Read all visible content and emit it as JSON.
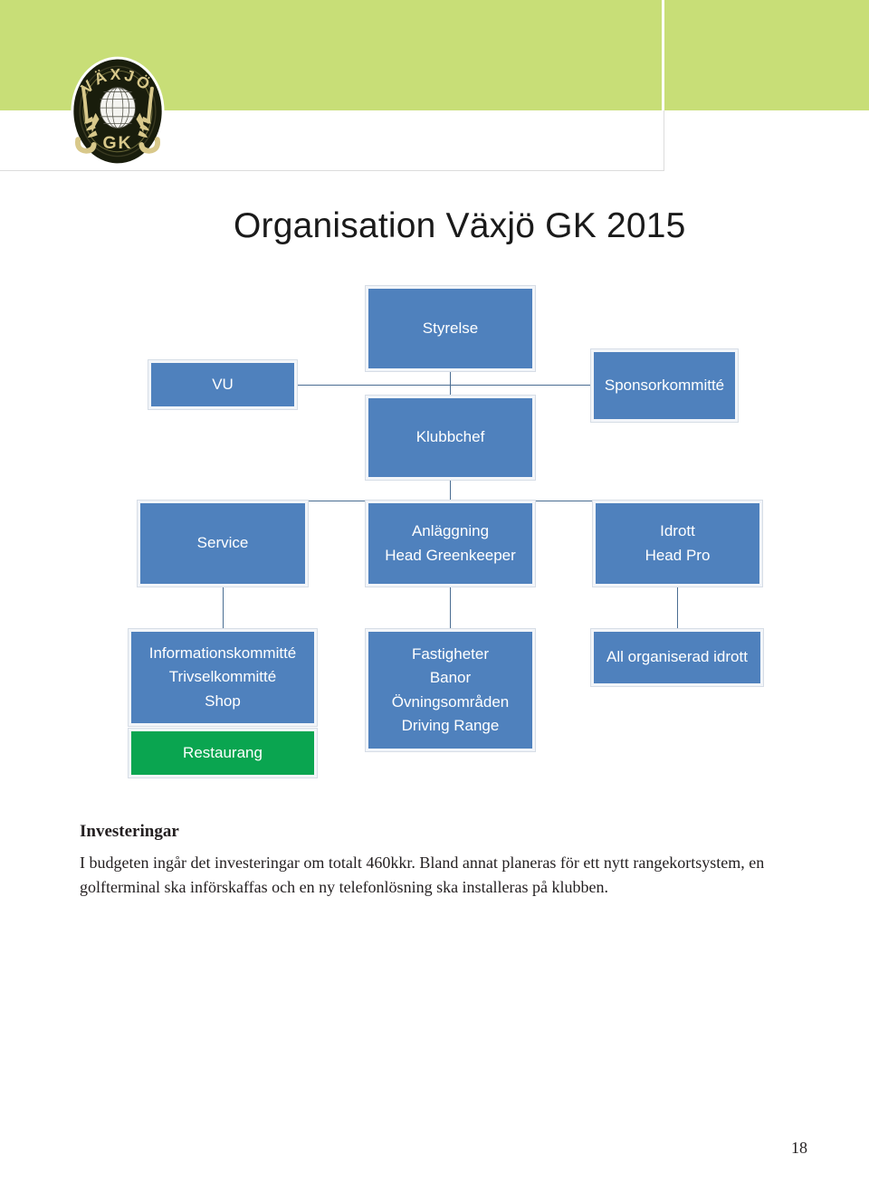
{
  "header": {
    "logo_alt": "Växjö GK club emblem",
    "logo_top_text": "VÄXJÖ",
    "logo_bottom_text": "GK",
    "band_color": "#c8de77"
  },
  "chart_data": {
    "type": "diagram",
    "title": "Organisation Växjö GK 2015",
    "node_color": "#4f81bd",
    "accent_color": "#0aa550",
    "connector_color": "#4a6d92",
    "nodes": [
      {
        "id": "styrelse",
        "lines": [
          "Styrelse"
        ],
        "color": "#4f81bd"
      },
      {
        "id": "vu",
        "lines": [
          "VU"
        ],
        "color": "#4f81bd"
      },
      {
        "id": "sponsor",
        "lines": [
          "Sponsorkommitté"
        ],
        "color": "#4f81bd"
      },
      {
        "id": "klubbchef",
        "lines": [
          "Klubbchef"
        ],
        "color": "#4f81bd"
      },
      {
        "id": "service",
        "lines": [
          "Service"
        ],
        "color": "#4f81bd"
      },
      {
        "id": "anlaggning",
        "lines": [
          "Anläggning",
          "Head Greenkeeper"
        ],
        "color": "#4f81bd"
      },
      {
        "id": "idrott",
        "lines": [
          "Idrott",
          "Head Pro"
        ],
        "color": "#4f81bd"
      },
      {
        "id": "service-sub",
        "lines": [
          "Informationskommitté",
          "Trivselkommitté",
          "Shop"
        ],
        "color": "#4f81bd"
      },
      {
        "id": "restaurang",
        "lines": [
          "Restaurang"
        ],
        "color": "#0aa550"
      },
      {
        "id": "anlaggning-sub",
        "lines": [
          "Fastigheter",
          "Banor",
          "Övningsområden",
          "Driving Range"
        ],
        "color": "#4f81bd"
      },
      {
        "id": "idrott-sub",
        "lines": [
          "All organiserad idrott"
        ],
        "color": "#4f81bd"
      }
    ],
    "edges": [
      {
        "from": "styrelse",
        "to": "klubbchef"
      },
      {
        "from": "styrelse",
        "to": "vu"
      },
      {
        "from": "styrelse",
        "to": "sponsor"
      },
      {
        "from": "klubbchef",
        "to": "service"
      },
      {
        "from": "klubbchef",
        "to": "anlaggning"
      },
      {
        "from": "klubbchef",
        "to": "idrott"
      },
      {
        "from": "service",
        "to": "service-sub"
      },
      {
        "from": "anlaggning",
        "to": "anlaggning-sub"
      },
      {
        "from": "idrott",
        "to": "idrott-sub"
      }
    ],
    "node_text": {
      "styrelse": "Styrelse",
      "vu": "VU",
      "sponsor": "Sponsorkommitté",
      "klubbchef": "Klubbchef",
      "service": "Service",
      "anlaggning_1": "Anläggning",
      "anlaggning_2": "Head Greenkeeper",
      "idrott_1": "Idrott",
      "idrott_2": "Head Pro",
      "service_sub_1": "Informationskommitté",
      "service_sub_2": "Trivselkommitté",
      "service_sub_3": "Shop",
      "restaurang": "Restaurang",
      "anlaggning_sub_1": "Fastigheter",
      "anlaggning_sub_2": "Banor",
      "anlaggning_sub_3": "Övningsområden",
      "anlaggning_sub_4": "Driving Range",
      "idrott_sub_1": "All organiserad idrott"
    }
  },
  "document": {
    "heading": "Investeringar",
    "paragraph": "I budgeten ingår det investeringar om totalt 460kkr. Bland annat planeras för ett nytt rangekortsystem, en golfterminal ska införskaffas och en ny telefonlösning ska installeras på klubben.",
    "page_number": "18"
  }
}
